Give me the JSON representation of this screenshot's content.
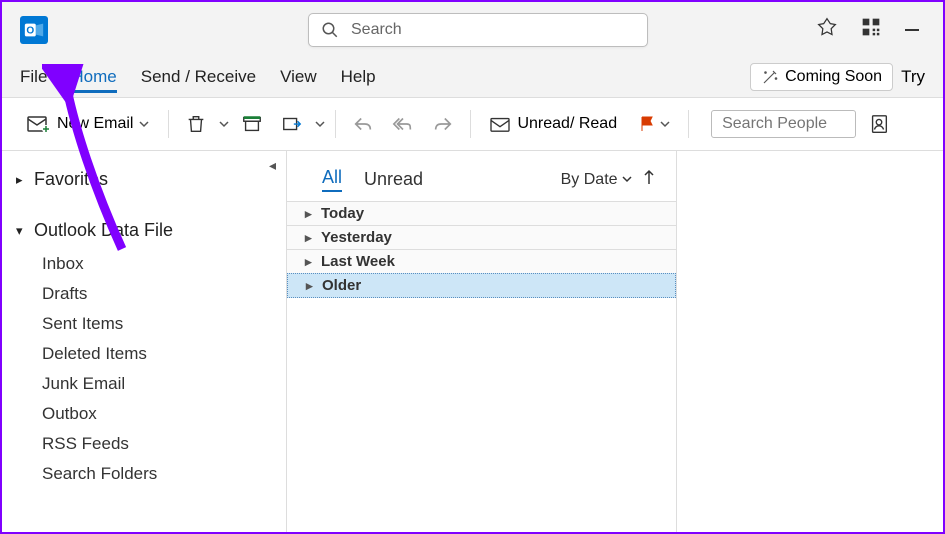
{
  "search": {
    "placeholder": "Search"
  },
  "tabs": {
    "file": "File",
    "home": "Home",
    "sendreceive": "Send / Receive",
    "view": "View",
    "help": "Help"
  },
  "titlebar_right": {
    "coming_soon": "Coming Soon",
    "try": "Try"
  },
  "ribbon": {
    "new_email": "New Email",
    "unread_read": "Unread/ Read",
    "search_people_placeholder": "Search People"
  },
  "sidebar": {
    "favorites": "Favorites",
    "datafile": "Outlook Data File",
    "items": [
      "Inbox",
      "Drafts",
      "Sent Items",
      "Deleted Items",
      "Junk Email",
      "Outbox",
      "RSS Feeds",
      "Search Folders"
    ]
  },
  "maillist": {
    "filters": {
      "all": "All",
      "unread": "Unread"
    },
    "sort": "By Date",
    "groups": [
      "Today",
      "Yesterday",
      "Last Week",
      "Older"
    ]
  }
}
